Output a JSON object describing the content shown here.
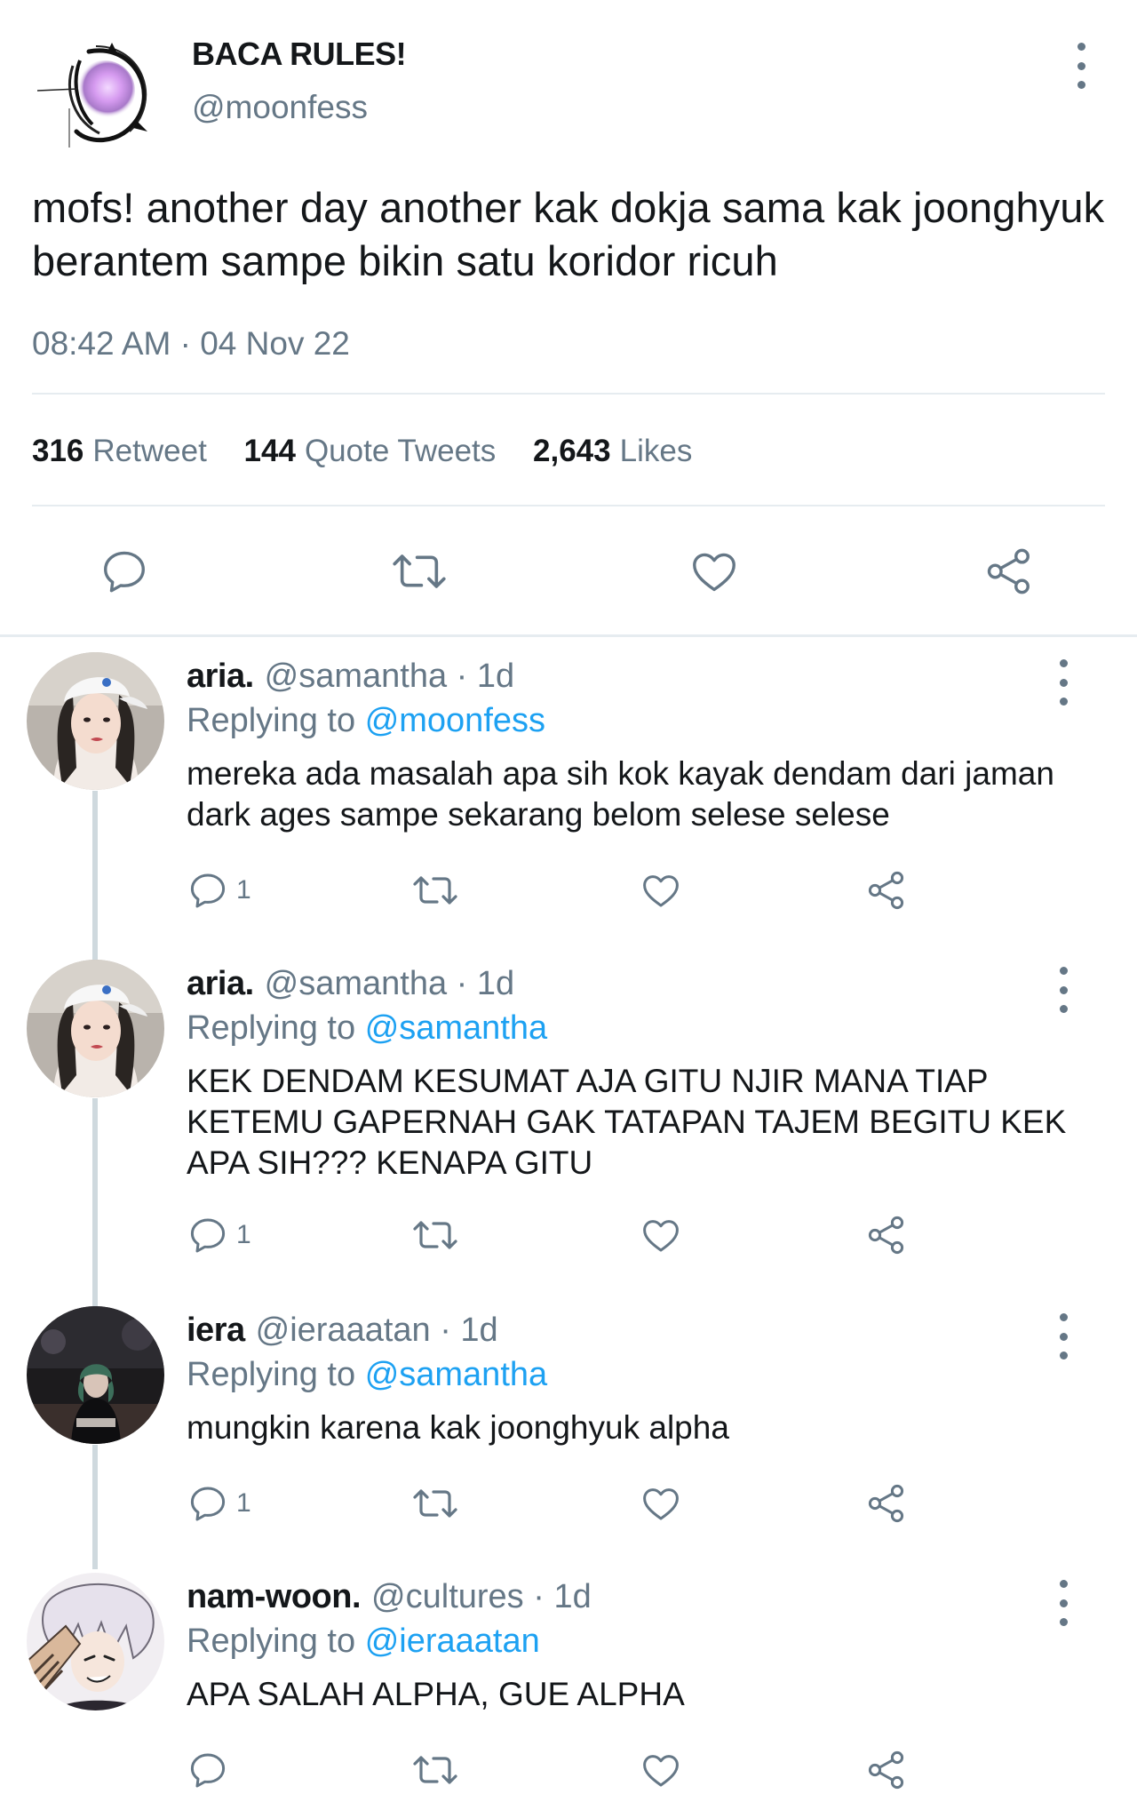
{
  "main_tweet": {
    "display_name": "BACA RULES!",
    "handle": "@moonfess",
    "text": "mofs! another day another kak dokja sama kak joonghyuk berantem sampe bikin satu koridor ricuh",
    "timestamp": "08:42 AM · 04 Nov 22",
    "stats": {
      "retweets": "316",
      "retweets_label": "Retweet",
      "quotes": "144",
      "quotes_label": "Quote Tweets",
      "likes": "2,643",
      "likes_label": "Likes"
    }
  },
  "replies": [
    {
      "name": "aria.",
      "handle": "@samantha · 1d",
      "replying_label": "Replying to",
      "replying_to": "@moonfess",
      "text": "mereka ada masalah apa sih kok kayak dendam dari jaman dark ages sampe sekarang belom selese selese",
      "reply_count": "1"
    },
    {
      "name": "aria.",
      "handle": "@samantha · 1d",
      "replying_label": "Replying to",
      "replying_to": "@samantha",
      "text": "KEK DENDAM KESUMAT AJA GITU NJIR MANA TIAP KETEMU GAPERNAH GAK TATAPAN TAJEM BEGITU KEK APA SIH??? KENAPA GITU",
      "reply_count": "1"
    },
    {
      "name": "iera",
      "handle": "@ieraaatan · 1d",
      "replying_label": "Replying to",
      "replying_to": "@samantha",
      "text": "mungkin karena kak joonghyuk alpha",
      "reply_count": "1"
    },
    {
      "name": "nam-woon.",
      "handle": "@cultures · 1d",
      "replying_label": "Replying to",
      "replying_to": "@ieraaatan",
      "text": "APA SALAH ALPHA, GUE ALPHA",
      "reply_count": ""
    }
  ],
  "icons": {
    "reply": "speech-bubble-icon",
    "retweet": "retweet-icon",
    "like": "heart-icon",
    "share": "share-icon",
    "more": "kebab-menu-icon"
  },
  "colors": {
    "text": "#14171a",
    "secondary": "#657786",
    "link": "#1da1f2",
    "divider": "#e6ecf0"
  }
}
